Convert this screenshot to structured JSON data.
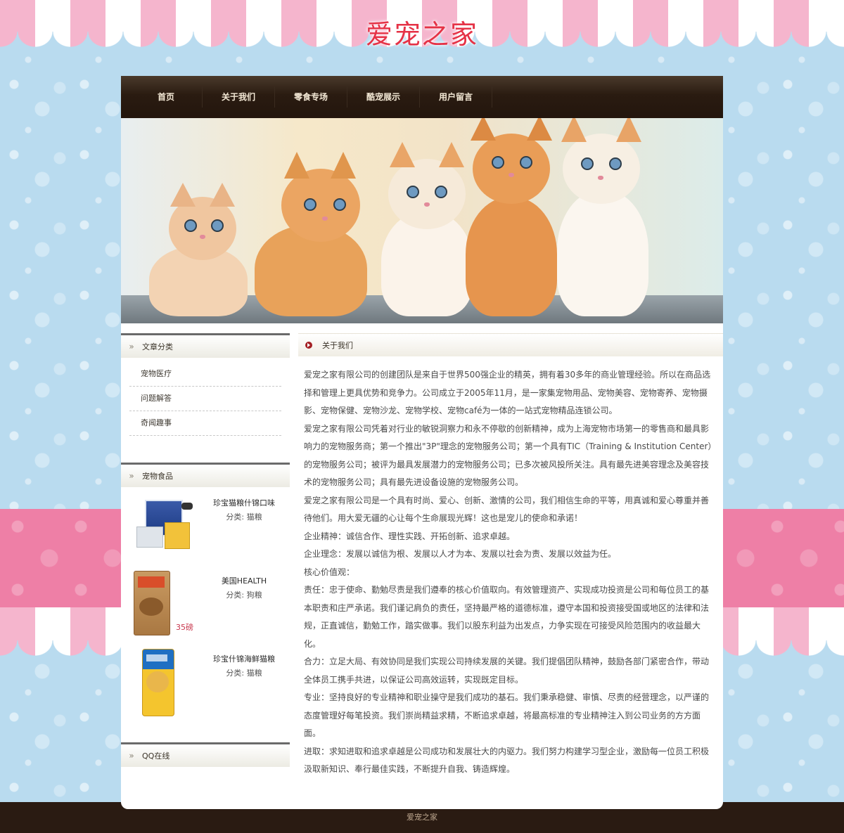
{
  "site": {
    "title": "爱宠之家"
  },
  "nav": {
    "items": [
      {
        "label": "首页"
      },
      {
        "label": "关于我们"
      },
      {
        "label": "零食专场"
      },
      {
        "label": "酷宠展示"
      },
      {
        "label": "用户留言"
      }
    ]
  },
  "sidebar": {
    "categories": {
      "title": "文章分类",
      "items": [
        {
          "label": "宠物医疗"
        },
        {
          "label": "问题解答"
        },
        {
          "label": "奇闻趣事"
        }
      ]
    },
    "food": {
      "title": "宠物食品",
      "category_prefix": "分类:",
      "items": [
        {
          "name": "珍宝猫粮什锦口味",
          "category": "猫粮",
          "image": "cat-food-box-image"
        },
        {
          "name": "美国HEALTH",
          "category": "狗粮",
          "image": "dog-food-bag-image",
          "badge": "35磅"
        },
        {
          "name": "珍宝什锦海鲜猫粮",
          "category": "猫粮",
          "image": "seafood-cat-food-bag-image"
        }
      ]
    },
    "qq": {
      "title": "QQ在线"
    }
  },
  "content": {
    "title": "关于我们",
    "paragraphs": [
      "爱宠之家有限公司的创建团队是来自于世界500强企业的精英，拥有着30多年的商业管理经验。所以在商品选择和管理上更具优势和竞争力。公司成立于2005年11月，是一家集宠物用品、宠物美容、宠物寄养、宠物摄影、宠物保健、宠物沙龙、宠物学校、宠物café为一体的一站式宠物精品连锁公司。",
      "爱宠之家有限公司凭着对行业的敏锐洞察力和永不停歇的创新精神，成为上海宠物市场第一的零售商和最具影响力的宠物服务商；第一个推出\"3P\"理念的宠物服务公司；第一个具有TIC（Training & Institution Center）的宠物服务公司；被评为最具发展潜力的宠物服务公司；已多次被风投所关注。具有最先进美容理念及美容技术的宠物服务公司；具有最先进设备设施的宠物服务公司。",
      "爱宠之家有限公司是一个具有时尚、爱心、创新、激情的公司，我们相信生命的平等，用真诚和爱心尊重并善待他们。用大爱无疆的心让每个生命展现光辉！这也是宠儿的使命和承诺！",
      "企业精神：诚信合作、理性实践、开拓创新、追求卓越。",
      "企业理念：发展以诚信为根、发展以人才为本、发展以社会为责、发展以效益为任。",
      "核心价值观：",
      "责任：忠于使命、勤勉尽责是我们遵奉的核心价值取向。有效管理资产、实现成功投资是公司和每位员工的基本职责和庄严承诺。我们谨记肩负的责任，坚持最严格的道德标准，遵守本国和投资接受国或地区的法律和法规，正直诚信，勤勉工作，踏实做事。我们以股东利益为出发点，力争实现在可接受风险范围内的收益最大化。",
      "合力：立足大局、有效协同是我们实现公司持续发展的关键。我们提倡团队精神，鼓励各部门紧密合作，带动全体员工携手共进，以保证公司高效运转，实现既定目标。",
      "专业：坚持良好的专业精神和职业操守是我们成功的基石。我们秉承稳健、审慎、尽责的经营理念，以严谨的态度管理好每笔投资。我们崇尚精益求精，不断追求卓越，将最高标准的专业精神注入到公司业务的方方面面。",
      "进取：求知进取和追求卓越是公司成功和发展壮大的内驱力。我们努力构建学习型企业，激励每一位员工积极汲取新知识、奉行最佳实践，不断提升自我、铸造辉煌。"
    ]
  },
  "banner": {
    "image": "five-kittens-banner-image"
  },
  "footer": {
    "text": "爱宠之家"
  },
  "colors": {
    "background_blue": "#b9dbef",
    "awning_pink": "#f5b5cd",
    "band_pink": "#ee7fa6",
    "title_red": "#e53246",
    "nav_brown": "#2a1b11",
    "footer_brown": "#2a1b12"
  }
}
